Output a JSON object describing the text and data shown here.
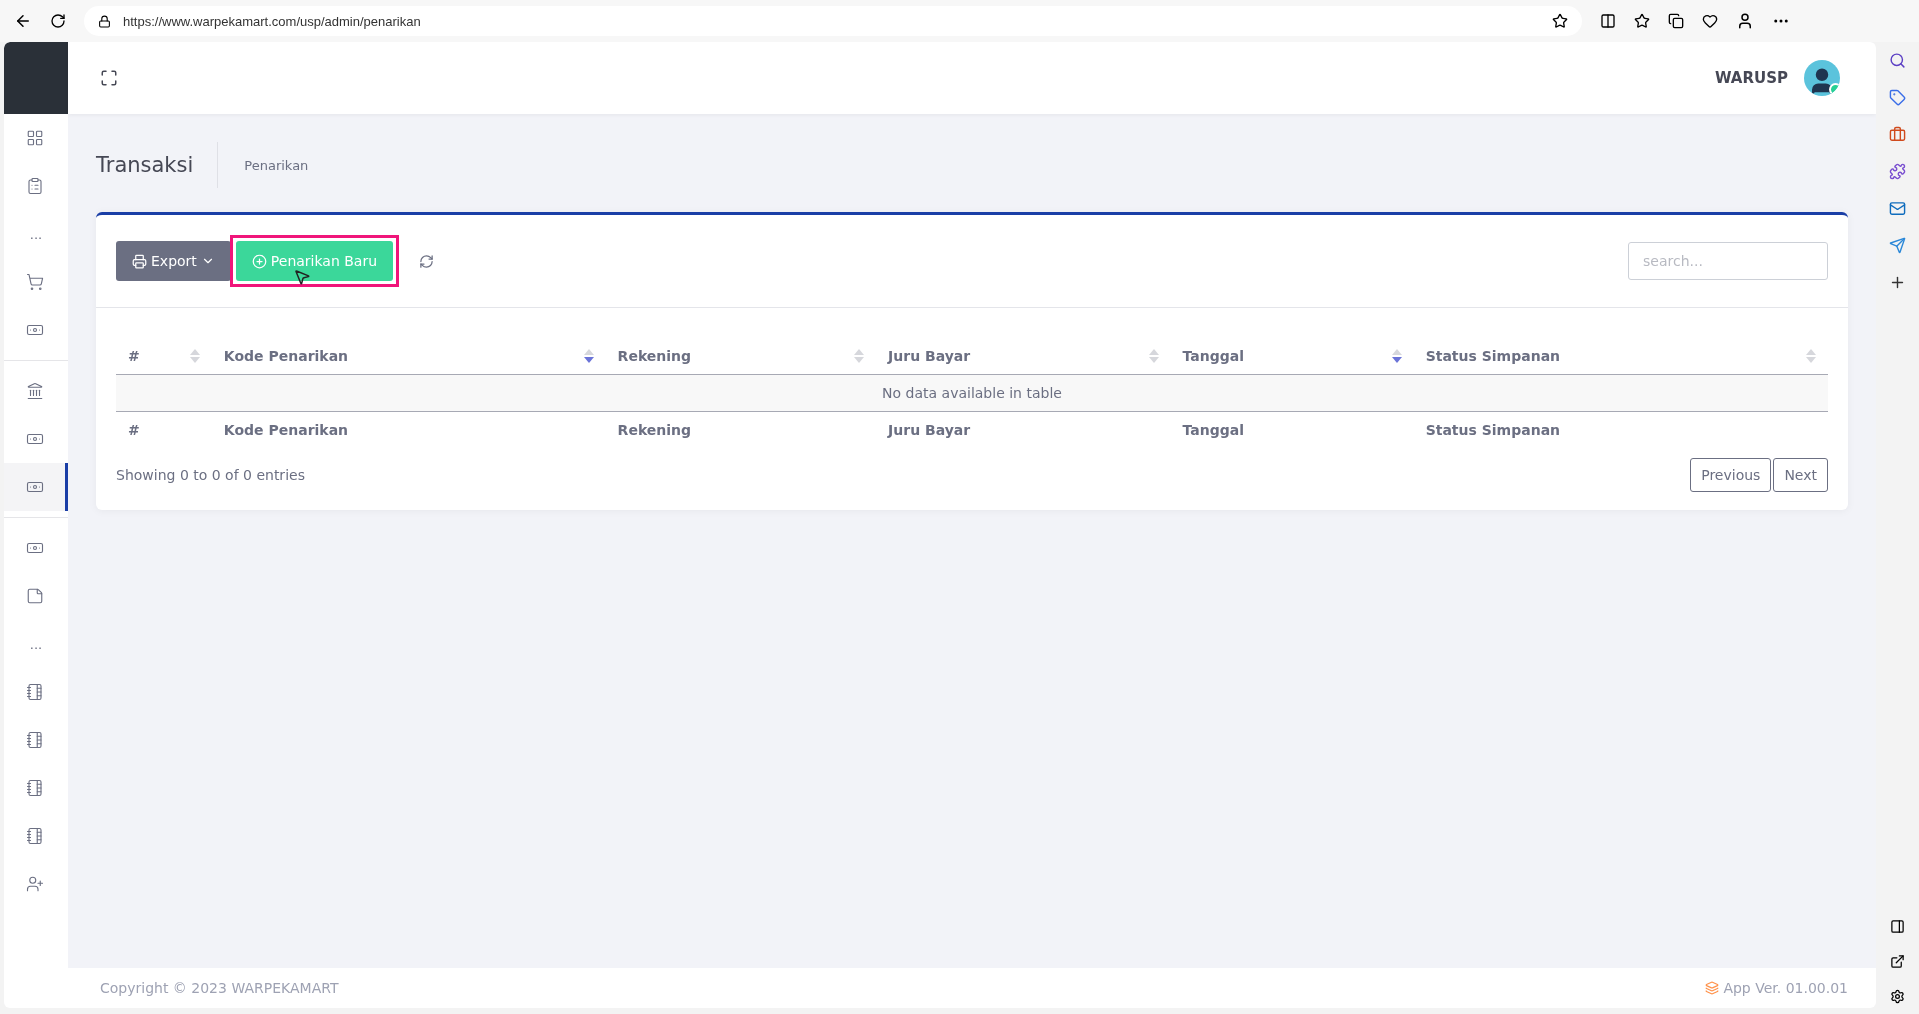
{
  "browser": {
    "url": "https://www.warpekamart.com/usp/admin/penarikan"
  },
  "sidebar": {
    "items": [
      {
        "kind": "dashboard",
        "selected": false
      },
      {
        "kind": "clipboard",
        "selected": false
      },
      {
        "kind": "more",
        "label": "..."
      },
      {
        "kind": "cart",
        "selected": false
      },
      {
        "kind": "cash",
        "selected": false
      },
      {
        "kind": "divider"
      },
      {
        "kind": "bank",
        "selected": false
      },
      {
        "kind": "cash",
        "selected": false
      },
      {
        "kind": "cash",
        "selected": true
      },
      {
        "kind": "divider"
      },
      {
        "kind": "cash",
        "selected": false
      },
      {
        "kind": "note",
        "selected": false
      },
      {
        "kind": "more",
        "label": "..."
      },
      {
        "kind": "notebook",
        "selected": false
      },
      {
        "kind": "notebook",
        "selected": false
      },
      {
        "kind": "notebook",
        "selected": false
      },
      {
        "kind": "notebook",
        "selected": false
      },
      {
        "kind": "user-add",
        "selected": false
      }
    ]
  },
  "header": {
    "user": "WARUSP",
    "online": true
  },
  "page": {
    "title": "Transaksi",
    "breadcrumb": "Penarikan"
  },
  "toolbar": {
    "export": "Export",
    "add": "Penarikan Baru",
    "add_highlighted": true,
    "search_placeholder": "search..."
  },
  "table": {
    "columns": [
      {
        "label": "#",
        "sorted": false
      },
      {
        "label": "Kode Penarikan",
        "sorted": true
      },
      {
        "label": "Rekening",
        "sorted": false
      },
      {
        "label": "Juru Bayar",
        "sorted": false
      },
      {
        "label": "Tanggal",
        "sorted": true
      },
      {
        "label": "Status Simpanan",
        "sorted": false
      }
    ],
    "empty": "No data available in table",
    "footer_columns": [
      "#",
      "Kode Penarikan",
      "Rekening",
      "Juru Bayar",
      "Tanggal",
      "Status Simpanan"
    ],
    "info": "Showing 0 to 0 of 0 entries",
    "pagination": [
      "Previous",
      "Next"
    ]
  },
  "footer": {
    "copyright": "Copyright © 2023 WARPEKAMART",
    "version": "App Ver. 01.00.01"
  }
}
